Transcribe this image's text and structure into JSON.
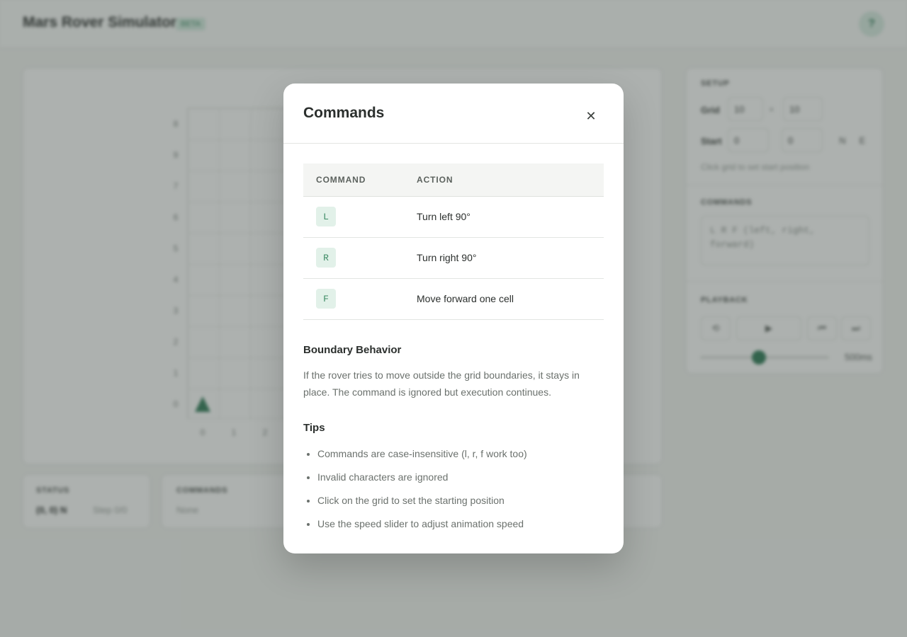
{
  "app": {
    "title": "Mars Rover Simulator",
    "badge": "BETA",
    "help_label": "?"
  },
  "grid": {
    "y_labels": [
      "8",
      "9",
      "7",
      "6",
      "5",
      "4",
      "3",
      "2",
      "1",
      "0"
    ],
    "x_labels": [
      "0",
      "1",
      "2"
    ]
  },
  "status": {
    "label": "STATUS",
    "value": "(0, 0) N",
    "step": "Step 0/0"
  },
  "commands_card": {
    "label": "COMMANDS",
    "value": "None"
  },
  "sidebar": {
    "setup_label": "SETUP",
    "grid_label": "Grid",
    "grid_w": "10",
    "grid_x": "×",
    "grid_h": "10",
    "start_label": "Start",
    "start_x": "0",
    "start_y": "0",
    "dir_1": "N",
    "dir_2": "E",
    "help": "Click grid to set start position",
    "commands_label": "COMMANDS",
    "commands_placeholder": "L R F (left, right, forward)",
    "playback_label": "PLAYBACK",
    "btn_reset": "⟲",
    "btn_play": "▶",
    "btn_back": "⏮",
    "btn_fwd": "⏭",
    "speed": "500ms"
  },
  "modal": {
    "title": "Commands",
    "close_glyph": "✕",
    "table": {
      "headers": [
        "COMMAND",
        "ACTION"
      ],
      "rows": [
        {
          "key": "L",
          "action": "Turn left 90°"
        },
        {
          "key": "R",
          "action": "Turn right 90°"
        },
        {
          "key": "F",
          "action": "Move forward one cell"
        }
      ]
    },
    "boundary_title": "Boundary Behavior",
    "boundary_text": "If the rover tries to move outside the grid boundaries, it stays in place. The command is ignored but execution continues.",
    "tips_title": "Tips",
    "tips": [
      "Commands are case-insensitive (l, r, f work too)",
      "Invalid characters are ignored",
      "Click on the grid to set the starting position",
      "Use the speed slider to adjust animation speed"
    ]
  },
  "colors": {
    "accent": "#2e7a57",
    "key_bg": "#e2f1e9",
    "overlay": "rgba(60,70,65,0.42)"
  }
}
